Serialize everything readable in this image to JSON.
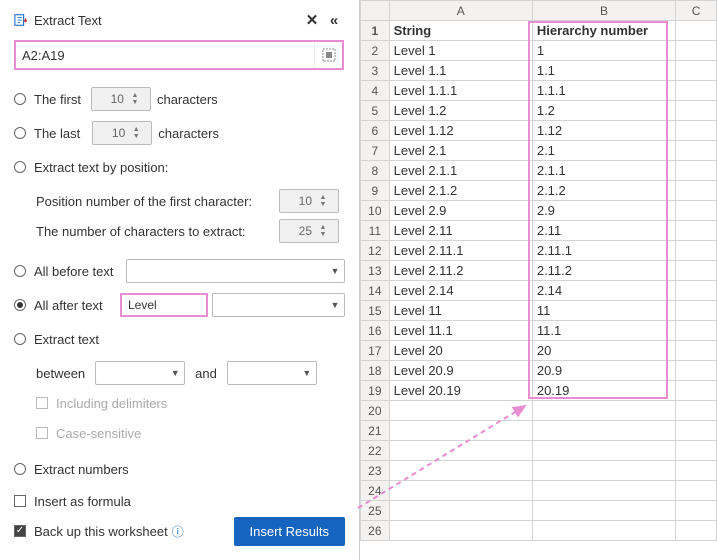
{
  "panel": {
    "title": "Extract Text",
    "range": "A2:A19",
    "first": {
      "label": "The first",
      "value": "10",
      "suffix": "characters"
    },
    "last": {
      "label": "The last",
      "value": "10",
      "suffix": "characters"
    },
    "bypos": {
      "label": "Extract text by position:",
      "firstchar": {
        "label": "Position number of the first character:",
        "value": "10"
      },
      "count": {
        "label": "The number of characters to extract:",
        "value": "25"
      }
    },
    "before": {
      "label": "All before text",
      "value": ""
    },
    "after": {
      "label": "All after text",
      "value": "Level "
    },
    "extract": {
      "label": "Extract text",
      "between": "between",
      "and": "and",
      "incl": "Including delimiters",
      "case": "Case-sensitive"
    },
    "numbers": "Extract numbers",
    "formula": "Insert as formula",
    "backup": "Back up this worksheet",
    "button": "Insert Results"
  },
  "sheet": {
    "cols": [
      "",
      "A",
      "B",
      "C"
    ],
    "rows": [
      {
        "n": "1",
        "a": "String",
        "b": "Hierarchy number",
        "hdr": true
      },
      {
        "n": "2",
        "a": "Level 1",
        "b": "1"
      },
      {
        "n": "3",
        "a": "Level 1.1",
        "b": "1.1"
      },
      {
        "n": "4",
        "a": "Level 1.1.1",
        "b": "1.1.1"
      },
      {
        "n": "5",
        "a": "Level 1.2",
        "b": "1.2"
      },
      {
        "n": "6",
        "a": "Level 1.12",
        "b": "1.12"
      },
      {
        "n": "7",
        "a": "Level 2.1",
        "b": "2.1"
      },
      {
        "n": "8",
        "a": "Level 2.1.1",
        "b": "2.1.1"
      },
      {
        "n": "9",
        "a": "Level 2.1.2",
        "b": "2.1.2"
      },
      {
        "n": "10",
        "a": "Level 2.9",
        "b": "2.9"
      },
      {
        "n": "11",
        "a": "Level 2.11",
        "b": "2.11"
      },
      {
        "n": "12",
        "a": "Level 2.11.1",
        "b": "2.11.1"
      },
      {
        "n": "13",
        "a": "Level 2.11.2",
        "b": "2.11.2"
      },
      {
        "n": "14",
        "a": "Level 2.14",
        "b": "2.14"
      },
      {
        "n": "15",
        "a": "Level 11",
        "b": "11"
      },
      {
        "n": "16",
        "a": "Level 11.1",
        "b": "11.1"
      },
      {
        "n": "17",
        "a": "Level 20",
        "b": "20"
      },
      {
        "n": "18",
        "a": "Level 20.9",
        "b": "20.9"
      },
      {
        "n": "19",
        "a": "Level 20.19",
        "b": "20.19"
      },
      {
        "n": "20",
        "a": "",
        "b": ""
      },
      {
        "n": "21",
        "a": "",
        "b": ""
      },
      {
        "n": "22",
        "a": "",
        "b": ""
      },
      {
        "n": "23",
        "a": "",
        "b": ""
      },
      {
        "n": "24",
        "a": "",
        "b": ""
      },
      {
        "n": "25",
        "a": "",
        "b": ""
      },
      {
        "n": "26",
        "a": "",
        "b": ""
      }
    ]
  }
}
